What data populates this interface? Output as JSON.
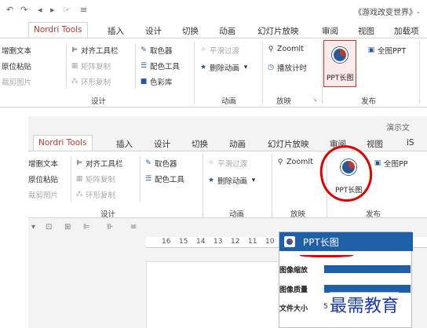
{
  "top": {
    "qat_icons": [
      "undo-icon",
      "redo-icon",
      "back-icon",
      "forward-icon",
      "touch-icon",
      "customize-icon"
    ],
    "doc_title": "《游戏改变世界》-",
    "tabs": [
      "Nordri Tools",
      "插入",
      "设计",
      "切换",
      "动画",
      "幻灯片放映",
      "审阅",
      "视图",
      "加载项"
    ],
    "groups": {
      "design": {
        "label": "设计",
        "col1": [
          "增删文本",
          "原位粘贴",
          "裁剪图片"
        ],
        "col2": [
          "对齐工具栏",
          "矩阵复制",
          "环形复制"
        ],
        "col3": [
          "取色器",
          "配色工具",
          "色彩库"
        ]
      },
      "animation": {
        "label": "动画",
        "items": [
          "平滑过渡",
          "删除动画"
        ]
      },
      "show": {
        "label": "放映",
        "items": [
          "ZoomIt",
          "播放计时"
        ]
      },
      "publish": {
        "label": "发布",
        "ppt_long": "PPT长图",
        "full_ppt": "全图PPT"
      }
    }
  },
  "bottom": {
    "doc_title": "演示文",
    "tabs": [
      "Nordri Tools",
      "插入",
      "设计",
      "切换",
      "动画",
      "幻灯片放映",
      "审阅",
      "视图",
      "iS"
    ],
    "groups": {
      "design": {
        "label": "设计",
        "col1": [
          "增删文本",
          "原位粘贴",
          "裁剪图片"
        ],
        "col2": [
          "对齐工具栏",
          "矩阵复制",
          "环形复制"
        ],
        "col3": [
          "取色器",
          "配色工具"
        ]
      },
      "animation": {
        "label": "动画",
        "items": [
          "平滑过渡",
          "删除动画"
        ]
      },
      "show": {
        "label": "放映",
        "items": [
          "ZoomIt"
        ]
      },
      "publish": {
        "label": "发布",
        "ppt_long": "PPT长图",
        "full_ppt": "全图PP"
      }
    },
    "ruler": [
      "16",
      "15",
      "14",
      "13",
      "12",
      "11",
      "10"
    ],
    "panel": {
      "title": "PPT长图",
      "rows": [
        "图像缩放",
        "图像质量",
        "文件大小"
      ],
      "file_size_prefix": "5"
    }
  },
  "watermark": "最需教育",
  "colors": {
    "accent_red": "#c0392b",
    "panel_blue": "#1f5fa8",
    "annotation_red": "#e00000"
  }
}
